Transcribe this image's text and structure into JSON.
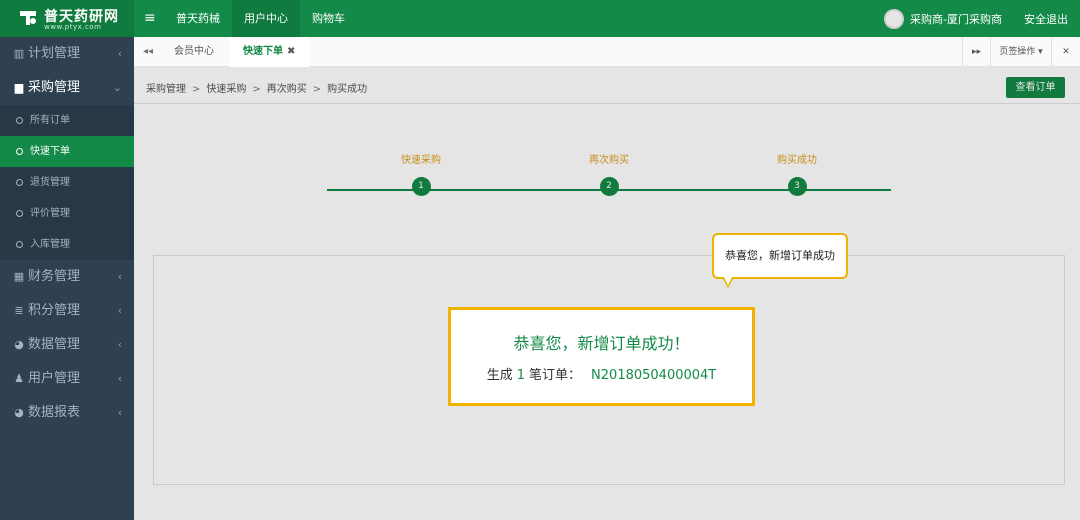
{
  "brand": {
    "title": "普天药研网",
    "url": "www.ptyx.com",
    "accent": "#138a47"
  },
  "topnav": {
    "items": [
      {
        "label": "普天药械"
      },
      {
        "label": "用户中心",
        "active": true
      },
      {
        "label": "购物车"
      }
    ]
  },
  "user": {
    "name": "采购商-厦门采购商",
    "logout": "安全退出"
  },
  "sidebar": {
    "groups": [
      {
        "label": "计划管理",
        "icon": "bar-chart-icon"
      },
      {
        "label": "采购管理",
        "icon": "bag-icon",
        "open": true,
        "items": [
          {
            "label": "所有订单"
          },
          {
            "label": "快速下单",
            "active": true
          },
          {
            "label": "退货管理"
          },
          {
            "label": "评价管理"
          },
          {
            "label": "入库管理"
          }
        ]
      },
      {
        "label": "财务管理",
        "icon": "calculator-icon"
      },
      {
        "label": "积分管理",
        "icon": "database-icon"
      },
      {
        "label": "数据管理",
        "icon": "pie-chart-icon"
      },
      {
        "label": "用户管理",
        "icon": "user-icon"
      },
      {
        "label": "数据报表",
        "icon": "pie-chart-icon"
      }
    ]
  },
  "tabs": {
    "items": [
      {
        "label": "会员中心"
      },
      {
        "label": "快速下单",
        "active": true,
        "close": "✖"
      }
    ],
    "page_ops": "页签操作"
  },
  "breadcrumb": {
    "items": [
      "采购管理",
      "快速采购",
      "再次购买",
      "购买成功"
    ],
    "separator": ">"
  },
  "view_order_button": "查看订单",
  "steps": [
    {
      "label": "快速采购",
      "num": "1"
    },
    {
      "label": "再次购买",
      "num": "2"
    },
    {
      "label": "购买成功",
      "num": "3"
    }
  ],
  "modal": {
    "title": "恭喜您，新增订单成功！",
    "prefix": "生成",
    "count": "1",
    "suffix": "笔订单：",
    "order_no": "N2018050400004T"
  },
  "tooltip": "恭喜您，新增订单成功",
  "highlight_color": "#f0b400"
}
